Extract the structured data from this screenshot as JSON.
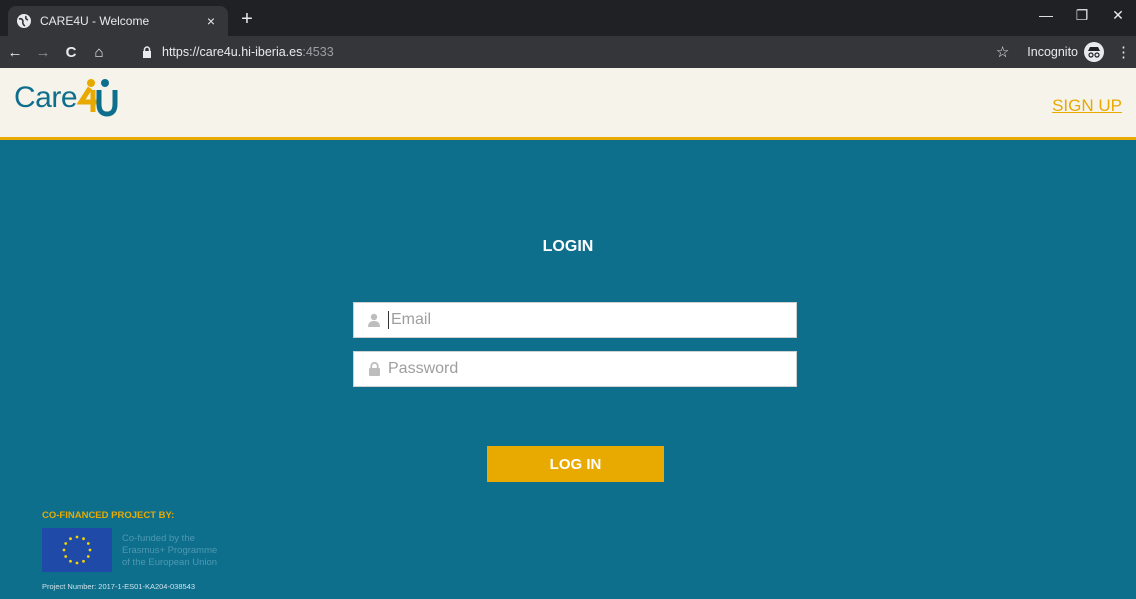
{
  "browser": {
    "tab_title": "CARE4U - Welcome",
    "tab_close": "×",
    "new_tab": "+",
    "window_minimize": "—",
    "window_restore": "❐",
    "window_close": "✕",
    "url_main": "https://care4u.hi-iberia.es",
    "url_port": ":4533",
    "incognito_label": "Incognito",
    "back": "←",
    "forward": "→",
    "reload": "C",
    "home": "⌂",
    "bookmark": "☆",
    "menu": "⋮"
  },
  "header": {
    "logo_text": "Care",
    "signup_label": "SIGN UP"
  },
  "login": {
    "title": "LOGIN",
    "email_placeholder": "Email",
    "password_placeholder": "Password",
    "button_label": "LOG IN"
  },
  "footer": {
    "cofinanced": "CO-FINANCED PROJECT BY:",
    "eu_line1": "Co-funded by the",
    "eu_line2": "Erasmus+ Programme",
    "eu_line3": "of the European Union",
    "project_number": "Project Number: 2017-1-ES01-KA204-038543"
  },
  "colors": {
    "brand_teal": "#0e6f8d",
    "brand_gold": "#e8aa00",
    "header_bg": "#f6f3eb"
  }
}
